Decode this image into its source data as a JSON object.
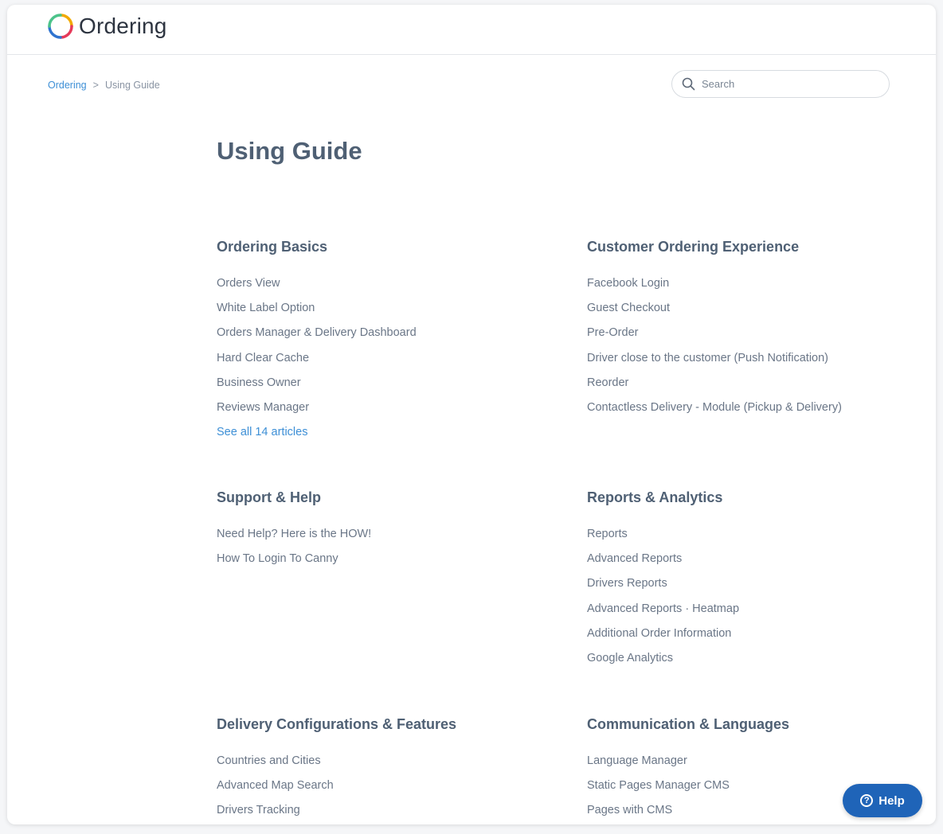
{
  "header": {
    "logo_text": "Ordering"
  },
  "breadcrumb": {
    "root": "Ordering",
    "separator": ">",
    "current": "Using Guide"
  },
  "search": {
    "placeholder": "Search"
  },
  "page_title": "Using Guide",
  "sections": [
    {
      "title": "Ordering Basics",
      "items": [
        "Orders View",
        "White Label Option",
        "Orders Manager & Delivery Dashboard",
        "Hard Clear Cache",
        "Business Owner",
        "Reviews Manager"
      ],
      "see_all": "See all 14 articles"
    },
    {
      "title": "Customer Ordering Experience",
      "items": [
        "Facebook Login",
        "Guest Checkout",
        "Pre-Order",
        "Driver close to the customer (Push Notification)",
        "Reorder",
        "Contactless Delivery - Module (Pickup & Delivery)"
      ]
    },
    {
      "title": "Support & Help",
      "items": [
        "Need Help? Here is the HOW!",
        "How To Login To Canny"
      ]
    },
    {
      "title": "Reports & Analytics",
      "items": [
        "Reports",
        "Advanced Reports",
        "Drivers Reports",
        "Advanced Reports · Heatmap",
        "Additional Order Information",
        "Google Analytics"
      ]
    },
    {
      "title": "Delivery Configurations & Features",
      "items": [
        "Countries and Cities",
        "Advanced Map Search",
        "Drivers Tracking"
      ]
    },
    {
      "title": "Communication & Languages",
      "items": [
        "Language Manager",
        "Static Pages Manager CMS",
        "Pages with CMS"
      ]
    }
  ],
  "help_button": {
    "label": "Help",
    "icon": "question-circle-icon"
  },
  "colors": {
    "accent": "#3d8fd6",
    "heading": "#4f6074",
    "help": "#1f64b8"
  }
}
